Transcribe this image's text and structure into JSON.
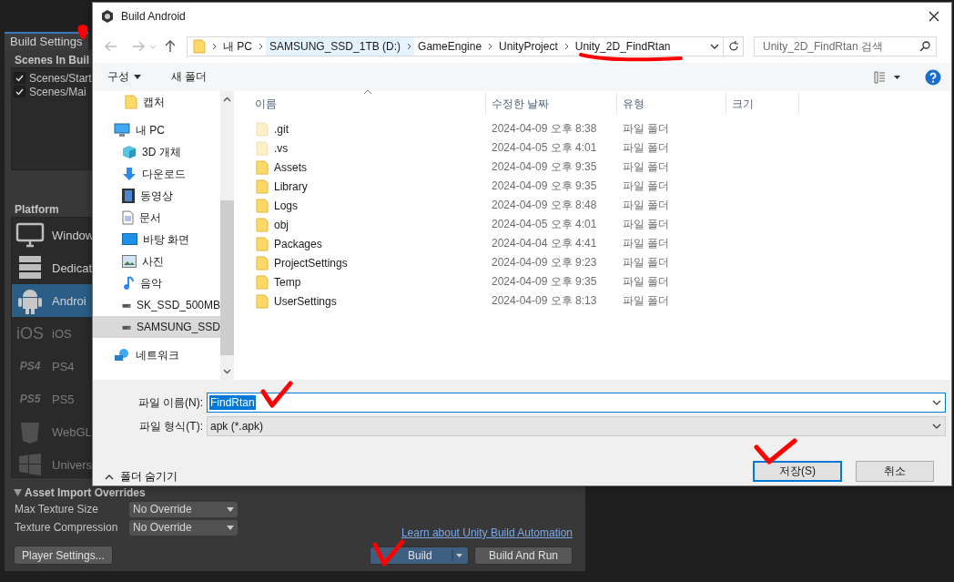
{
  "editor": {
    "tab": "Build Settings",
    "scenes_header": "Scenes In Buil",
    "scenes": [
      {
        "label": "Scenes/Start",
        "checked": true
      },
      {
        "label": "Scenes/Mai",
        "checked": true
      }
    ],
    "platform_header": "Platform",
    "platforms": [
      {
        "kind": "monitor",
        "label": "Window",
        "available": true,
        "selected": false
      },
      {
        "kind": "server",
        "label": "Dedicat",
        "available": true,
        "selected": false
      },
      {
        "kind": "android",
        "label": "Androi",
        "available": true,
        "selected": true
      },
      {
        "kind": "text_logo",
        "icon_text": "iOS",
        "label": "iOS",
        "available": false,
        "selected": false
      },
      {
        "kind": "text_logo",
        "icon_text": "PS4",
        "label": "PS4",
        "available": false,
        "selected": false
      },
      {
        "kind": "text_logo",
        "icon_text": "PS5",
        "label": "PS5",
        "available": false,
        "selected": false
      },
      {
        "kind": "shield",
        "label": "WebGL",
        "available": false,
        "selected": false
      },
      {
        "kind": "windows",
        "label": "Univers",
        "available": false,
        "selected": false
      }
    ],
    "overrides": {
      "title": "Asset Import Overrides",
      "expanded": true,
      "rows": [
        {
          "label": "Max Texture Size",
          "value": "No Override"
        },
        {
          "label": "Texture Compression",
          "value": "No Override"
        }
      ]
    },
    "player_settings": "Player Settings...",
    "link": "Learn about Unity Build Automation",
    "build": "Build",
    "build_and_run": "Build And Run"
  },
  "dialog": {
    "title": "Build Android",
    "path": [
      {
        "label": "내 PC",
        "selected": false
      },
      {
        "label": "SAMSUNG_SSD_1TB (D:)",
        "selected": true
      },
      {
        "label": "GameEngine",
        "selected": false
      },
      {
        "label": "UnityProject",
        "selected": false
      },
      {
        "label": "Unity_2D_FindRtan",
        "selected": false
      }
    ],
    "search": {
      "placeholder": "Unity_2D_FindRtan 검색"
    },
    "organize": "구성",
    "new_folder": "새 폴더",
    "nav": [
      {
        "kind": "folder",
        "label": "캡처",
        "selected": false
      },
      {
        "kind": "pc",
        "label": "내 PC",
        "selected": false,
        "children": [
          {
            "kind": "cube",
            "label": "3D 개체",
            "selected": false
          },
          {
            "kind": "download",
            "label": "다운로드",
            "selected": false
          },
          {
            "kind": "video",
            "label": "동영상",
            "selected": false
          },
          {
            "kind": "document",
            "label": "문서",
            "selected": false
          },
          {
            "kind": "desktop",
            "label": "바탕 화면",
            "selected": false
          },
          {
            "kind": "picture",
            "label": "사진",
            "selected": false
          },
          {
            "kind": "music",
            "label": "음악",
            "selected": false
          },
          {
            "kind": "drive",
            "label": "SK_SSD_500MB",
            "selected": false
          },
          {
            "kind": "drive",
            "label": "SAMSUNG_SSD",
            "selected": true
          }
        ]
      },
      {
        "kind": "network",
        "label": "네트워크",
        "selected": false
      }
    ],
    "columns": [
      "이름",
      "수정한 날짜",
      "유형",
      "크기"
    ],
    "files": [
      {
        "name": ".git",
        "modified": "2024-04-09 오후 8:38",
        "type": "파일 폴더",
        "hidden": true
      },
      {
        "name": ".vs",
        "modified": "2024-04-05 오후 4:01",
        "type": "파일 폴더",
        "hidden": true
      },
      {
        "name": "Assets",
        "modified": "2024-04-09 오후 9:35",
        "type": "파일 폴더",
        "hidden": false
      },
      {
        "name": "Library",
        "modified": "2024-04-09 오후 9:35",
        "type": "파일 폴더",
        "hidden": false
      },
      {
        "name": "Logs",
        "modified": "2024-04-09 오후 8:48",
        "type": "파일 폴더",
        "hidden": false
      },
      {
        "name": "obj",
        "modified": "2024-04-05 오후 4:01",
        "type": "파일 폴더",
        "hidden": false
      },
      {
        "name": "Packages",
        "modified": "2024-04-04 오후 4:41",
        "type": "파일 폴더",
        "hidden": false
      },
      {
        "name": "ProjectSettings",
        "modified": "2024-04-09 오후 9:23",
        "type": "파일 폴더",
        "hidden": false
      },
      {
        "name": "Temp",
        "modified": "2024-04-09 오후 9:35",
        "type": "파일 폴더",
        "hidden": false
      },
      {
        "name": "UserSettings",
        "modified": "2024-04-09 오후 8:13",
        "type": "파일 폴더",
        "hidden": false
      }
    ],
    "filename": {
      "label": "파일 이름(N):",
      "value": "FindRtan",
      "highlighted": true
    },
    "filetype": {
      "label": "파일 형식(T):",
      "value": "apk (*.apk)"
    },
    "hide_folders": "폴더 숨기기",
    "buttons": [
      {
        "label": "저장(S)",
        "default": true
      },
      {
        "label": "취소",
        "default": false
      }
    ]
  }
}
